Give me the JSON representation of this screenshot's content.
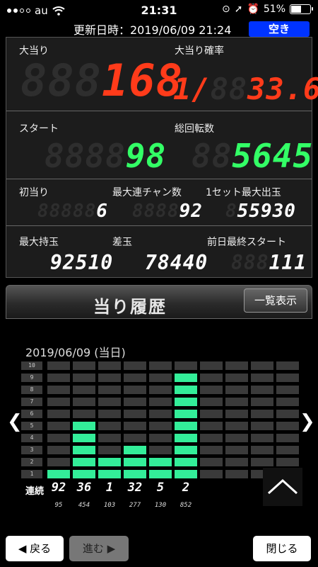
{
  "status_bar": {
    "carrier": "au",
    "time": "21:31",
    "battery": "51%"
  },
  "header": {
    "update_label": "更新日時：2019/06/09 21:24",
    "vacancy": "空き"
  },
  "stats": {
    "jackpot": {
      "label": "大当り",
      "value": "168",
      "ghost": "888"
    },
    "jackpot_prob": {
      "label": "大当り確率",
      "prefix": "1/",
      "value": "33.6",
      "ghost": "88"
    },
    "start": {
      "label": "スタート",
      "value": "98",
      "ghost": "8888"
    },
    "total_spins": {
      "label": "総回転数",
      "value": "5645",
      "ghost": "88"
    },
    "first_hit": {
      "label": "初当り",
      "value": "6",
      "ghost": "88888"
    },
    "max_chain": {
      "label": "最大連チャン数",
      "value": "92",
      "ghost": "8888"
    },
    "max_set": {
      "label": "1セット最大出玉",
      "value": "55930",
      "ghost": "8"
    },
    "max_hold": {
      "label": "最大持玉",
      "value": "92510",
      "ghost": ""
    },
    "diff": {
      "label": "差玉",
      "value": "78440",
      "ghost": ""
    },
    "prev_start": {
      "label": "前日最終スタート",
      "value": "111",
      "ghost": "888"
    }
  },
  "history": {
    "title": "当り履歴",
    "list_button": "一覧表示",
    "date": "2019/06/09 (当日)",
    "runs_label": "連続",
    "row_labels": [
      "10",
      "9",
      "8",
      "7",
      "6",
      "5",
      "4",
      "3",
      "2",
      "1"
    ],
    "columns": [
      {
        "runs": "92",
        "spins": "95",
        "level": 1
      },
      {
        "runs": "36",
        "spins": "454",
        "level": 5
      },
      {
        "runs": "1",
        "spins": "103",
        "level": 2
      },
      {
        "runs": "32",
        "spins": "277",
        "level": 3
      },
      {
        "runs": "5",
        "spins": "130",
        "level": 2
      },
      {
        "runs": "2",
        "spins": "852",
        "level": 9
      },
      {
        "runs": "",
        "spins": "",
        "level": 0
      },
      {
        "runs": "",
        "spins": "",
        "level": 0
      },
      {
        "runs": "",
        "spins": "",
        "level": 0
      },
      {
        "runs": "",
        "spins": "",
        "level": 0
      }
    ]
  },
  "footer": {
    "back": "◀ 戻る",
    "forward": "進む ▶",
    "close": "閉じる"
  }
}
